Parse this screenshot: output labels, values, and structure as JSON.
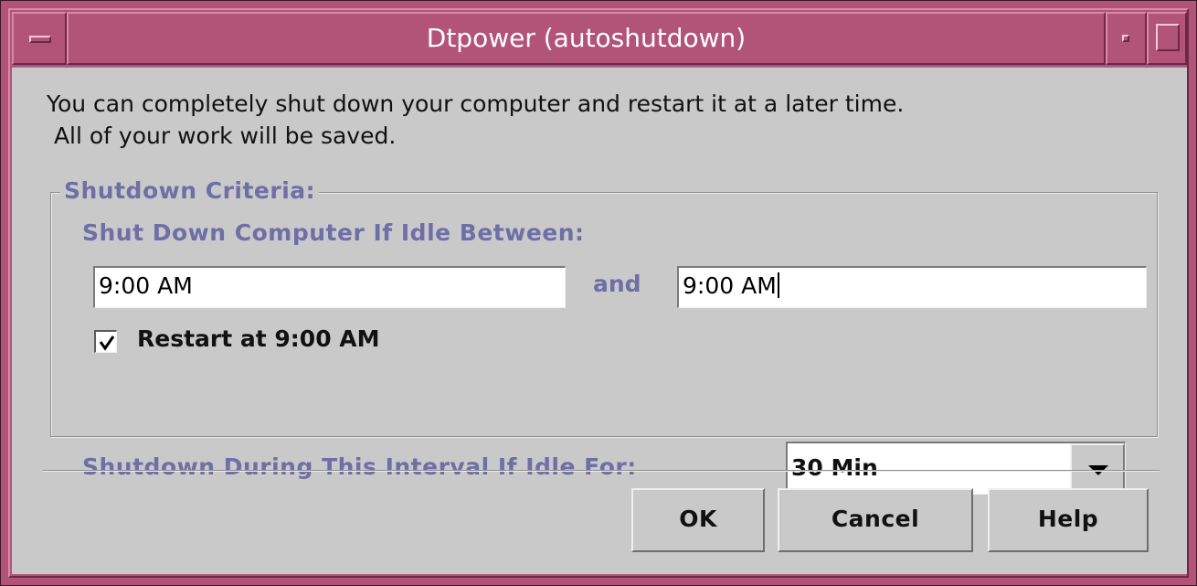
{
  "window": {
    "title": "Dtpower (autoshutdown)"
  },
  "intro": {
    "line1": "You can completely shut down your computer and restart it at a later time.",
    "line2": " All of your work will be saved."
  },
  "criteria": {
    "legend": "Shutdown Criteria:",
    "idle_between_label": "Shut Down Computer If Idle Between:",
    "start_time": "9:00 AM",
    "and_label": "and",
    "end_time": "9:00 AM",
    "restart_checkbox": {
      "label": "Restart at 9:00 AM",
      "checked": true
    },
    "interval_label": "Shutdown During This Interval If Idle For:",
    "interval_value": "30 Min"
  },
  "buttons": {
    "ok": "OK",
    "cancel": "Cancel",
    "help": "Help"
  },
  "colors": {
    "frame": "#b25478",
    "label_accent": "#6f6fa8",
    "dialog_background": "#c9c9c9"
  },
  "icons": {
    "window_menu": "window-menu-icon",
    "minimize": "minimize-icon",
    "maximize": "maximize-icon",
    "checkmark": "checkmark-icon",
    "dropdown": "chevron-down-icon"
  }
}
